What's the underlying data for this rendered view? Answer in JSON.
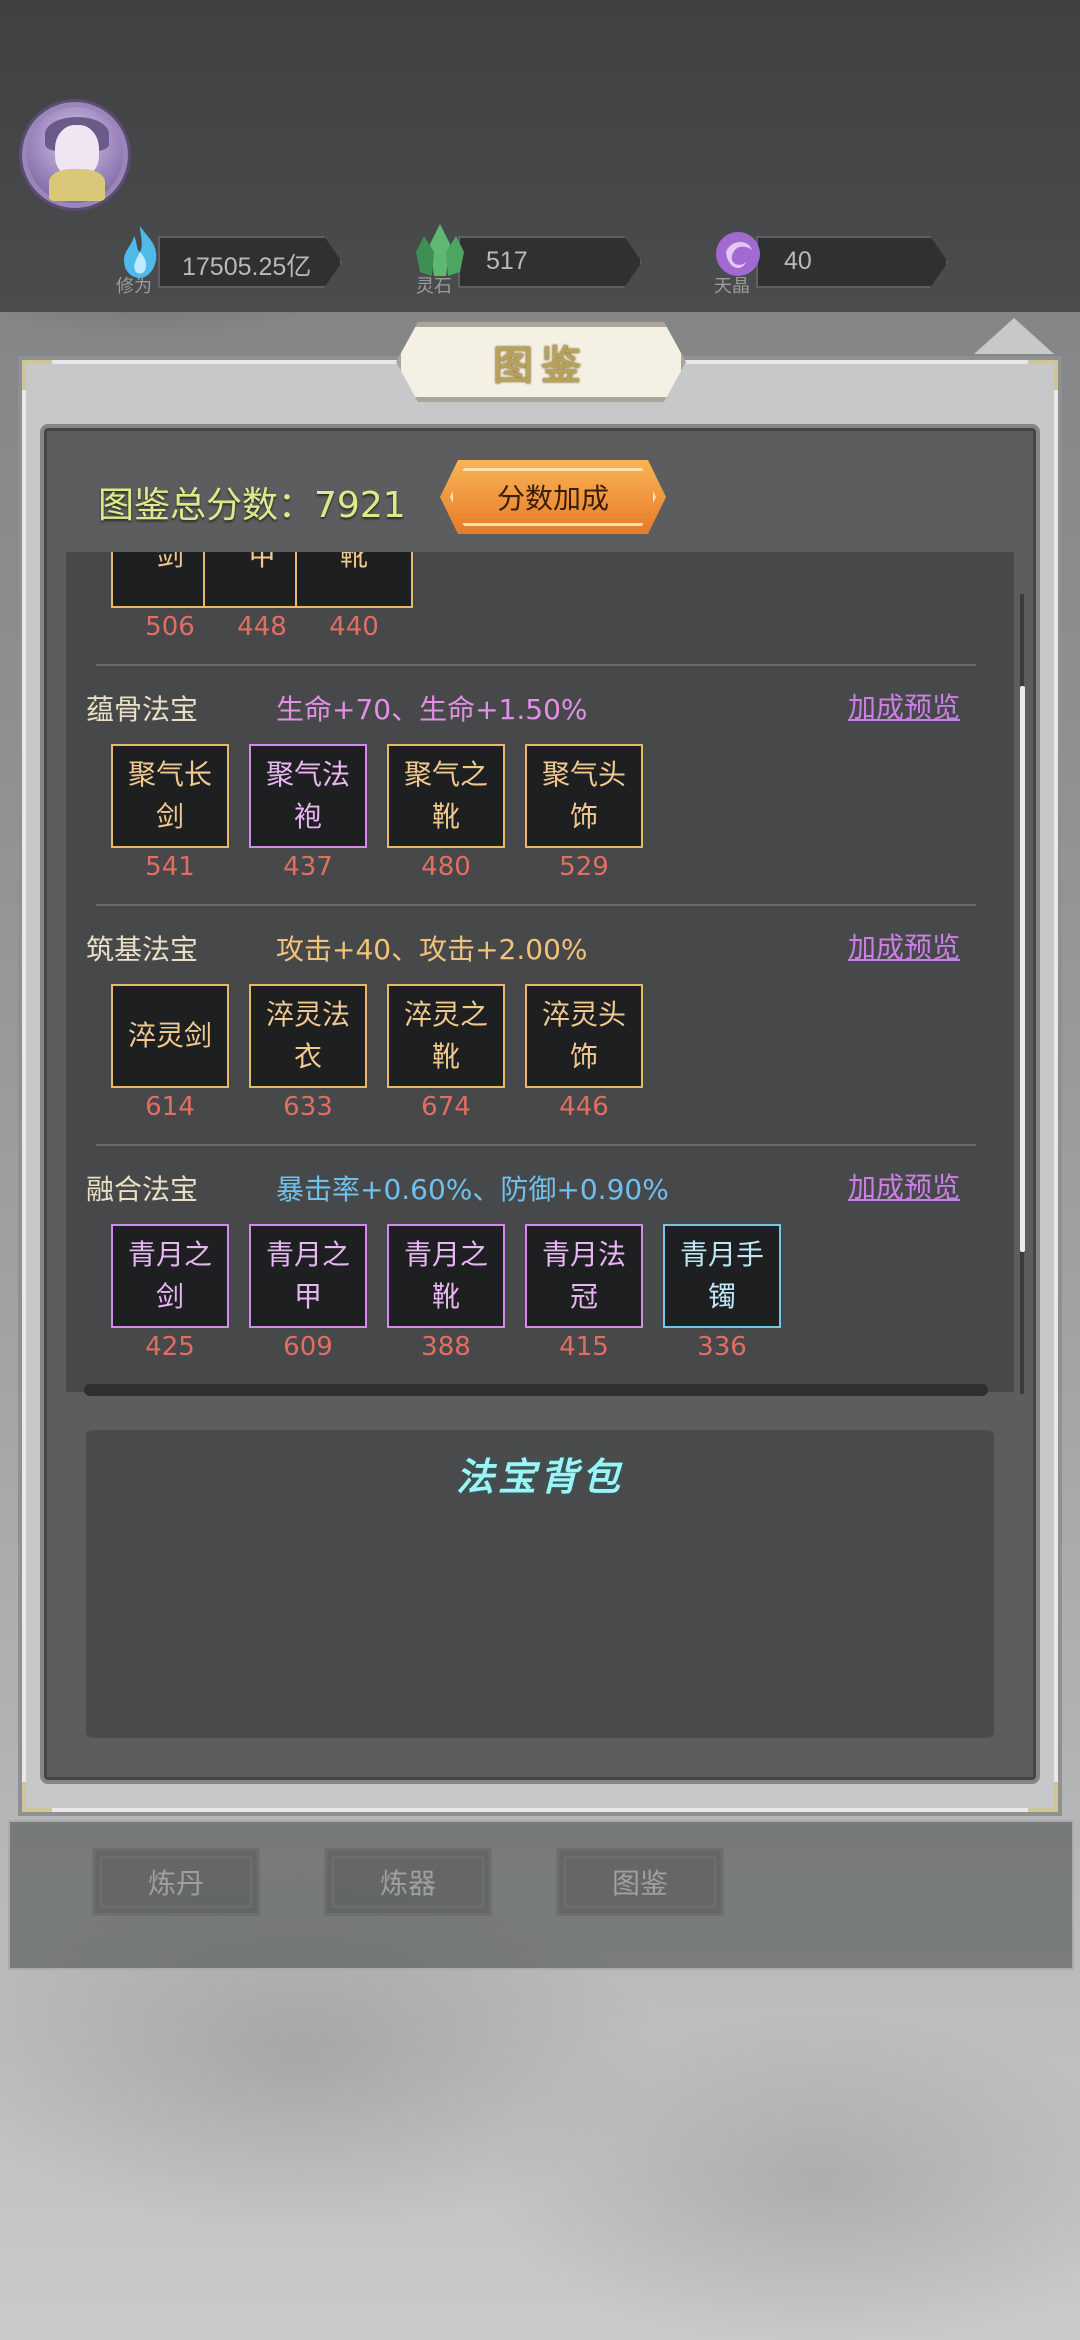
{
  "hud": {
    "resources": [
      {
        "value": "17505.25亿",
        "caption": "修为",
        "icon": "blue-flame-icon",
        "color": "#4fb9e8"
      },
      {
        "value": "517",
        "caption": "灵石",
        "icon": "green-crystal-icon",
        "color": "#5fb872"
      },
      {
        "value": "40",
        "caption": "天晶",
        "icon": "purple-gem-icon",
        "color": "#a06ad0"
      }
    ]
  },
  "panel": {
    "title": "图鉴",
    "score_label": "图鉴总分数：",
    "score_value": "7921",
    "bonus_button": "分数加成"
  },
  "partial_row": {
    "items": [
      {
        "name": "剑",
        "score": "506"
      },
      {
        "name": "甲",
        "score": "448"
      },
      {
        "name": "靴",
        "score": "440"
      }
    ]
  },
  "sets": [
    {
      "name": "蕴骨法宝",
      "bonus": "生命+70、生命+1.50%",
      "bonus_color": "#e290e6",
      "preview": "加成预览",
      "items": [
        {
          "name": "聚气长剑",
          "score": "541",
          "quality": "gold"
        },
        {
          "name": "聚气法袍",
          "score": "437",
          "quality": "purple"
        },
        {
          "name": "聚气之靴",
          "score": "480",
          "quality": "gold"
        },
        {
          "name": "聚气头饰",
          "score": "529",
          "quality": "gold"
        }
      ]
    },
    {
      "name": "筑基法宝",
      "bonus": "攻击+40、攻击+2.00%",
      "bonus_color": "#f0c27a",
      "preview": "加成预览",
      "items": [
        {
          "name": "淬灵剑",
          "score": "614",
          "quality": "gold"
        },
        {
          "name": "淬灵法衣",
          "score": "633",
          "quality": "gold"
        },
        {
          "name": "淬灵之靴",
          "score": "674",
          "quality": "gold"
        },
        {
          "name": "淬灵头饰",
          "score": "446",
          "quality": "gold"
        }
      ]
    },
    {
      "name": "融合法宝",
      "bonus": "暴击率+0.60%、防御+0.90%",
      "bonus_color": "#6fc0ee",
      "preview": "加成预览",
      "items": [
        {
          "name": "青月之剑",
          "score": "425",
          "quality": "purple"
        },
        {
          "name": "青月之甲",
          "score": "609",
          "quality": "purple"
        },
        {
          "name": "青月之靴",
          "score": "388",
          "quality": "purple"
        },
        {
          "name": "青月法冠",
          "score": "415",
          "quality": "purple"
        },
        {
          "name": "青月手镯",
          "score": "336",
          "quality": "blue"
        }
      ]
    }
  ],
  "bag": {
    "title": "法宝背包"
  },
  "tabs": [
    {
      "label": "炼丹"
    },
    {
      "label": "炼器"
    },
    {
      "label": "图鉴"
    }
  ]
}
